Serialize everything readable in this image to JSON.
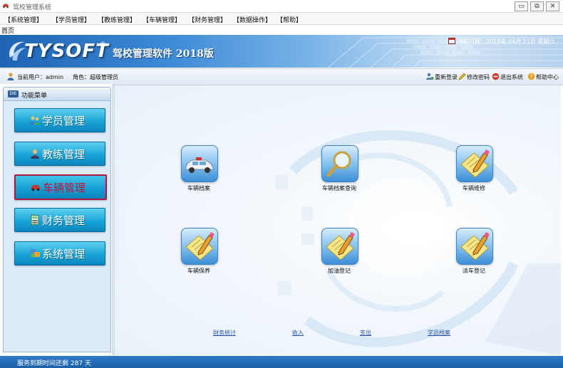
{
  "window": {
    "title": "驾校管理系统",
    "minimize_glyph": "▭",
    "maximize_glyph": "⧉",
    "close_glyph": "✕"
  },
  "menu": [
    "【系统管理】",
    "【学员管理】",
    "【教练管理】",
    "【车辆管理】",
    "【财务管理】",
    "【数据操作】",
    "【帮助】"
  ],
  "tabs": {
    "home": "首页"
  },
  "banner": {
    "logo": "TYSOFT",
    "registered": "®",
    "product": "驾校管理软件 2018版",
    "date_label": "当前日期：2018年 04月 21日   星期六"
  },
  "user_bar": {
    "current_user": "当前用户：admin",
    "role": "角色：超级管理员",
    "actions": {
      "relogin": "重新登录",
      "change_password": "修改密码",
      "exit": "退出系统",
      "help": "帮助中心"
    }
  },
  "sidebar": {
    "header": "功能菜单",
    "badge": "DIE",
    "items": [
      {
        "label": "学员管理",
        "icon": "students-icon"
      },
      {
        "label": "教练管理",
        "icon": "coach-icon"
      },
      {
        "label": "车辆管理",
        "icon": "car-icon"
      },
      {
        "label": "财务管理",
        "icon": "calculator-icon"
      },
      {
        "label": "系统管理",
        "icon": "system-icon"
      }
    ],
    "active_index": 2
  },
  "tiles": {
    "vehicle_file": "车辆档案",
    "vehicle_query": "车辆档案查询",
    "vehicle_repair": "车辆维修",
    "vehicle_maintenance": "车辆保养",
    "refuel": "加油登记",
    "dispatch": "派车登记"
  },
  "links": {
    "finance_stats": "财务统计",
    "income": "收入",
    "expense": "支出",
    "student_files": "学员档案"
  },
  "status": {
    "text": "服务到期时间还剩   287  天"
  },
  "colors": {
    "banner_blue": "#1f63b4",
    "nav_blue": "#19a4d6",
    "active_red": "#c4123f",
    "status_blue": "#1b5fa8"
  }
}
